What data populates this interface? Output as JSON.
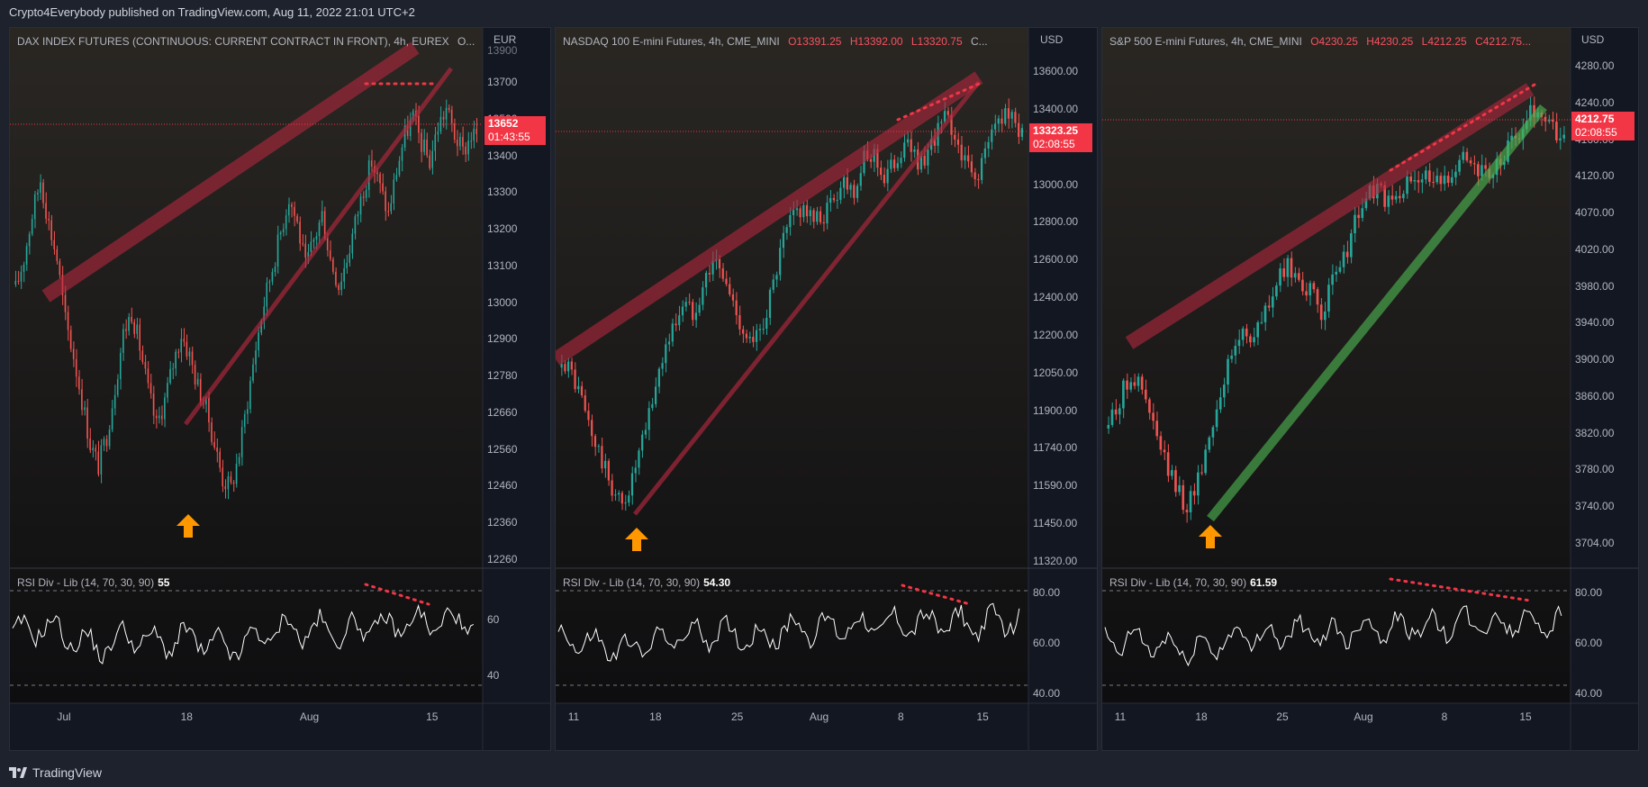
{
  "header": {
    "publisher": "Crypto4Everybody published on TradingView.com, Aug 11, 2022 21:01 UTC+2"
  },
  "footer": {
    "brand": "TradingView"
  },
  "colors": {
    "up": "#26a69a",
    "down": "#ef5350",
    "wedge": "#b2283d",
    "support": "#4caf50",
    "price_tag": "#f23645",
    "arrow": "#ff9800"
  },
  "panels": [
    {
      "id": "dax",
      "legend": {
        "title": "DAX INDEX FUTURES (CONTINUOUS: CURRENT CONTRACT IN FRONT), 4h, EUREX",
        "ohlc": "O..."
      },
      "currency": "EUR",
      "ticks": [
        "13700",
        "13500",
        "13400",
        "13300",
        "13200",
        "13100",
        "13000",
        "12900",
        "12780",
        "12660",
        "12560",
        "12460",
        "12360",
        "12260"
      ],
      "top_tick_cut": "13900",
      "price": {
        "value": "13652",
        "timer": "01:43:55"
      },
      "rsi": {
        "label": "RSI Div - Lib (14, 70, 30, 90)",
        "value": "55",
        "ticks": [
          "60",
          "40"
        ]
      },
      "xticks": [
        "Jul",
        "18",
        "Aug",
        "15"
      ],
      "series_pct": [
        0.55,
        0.62,
        0.72,
        0.8,
        0.7,
        0.62,
        0.48,
        0.4,
        0.3,
        0.2,
        0.15,
        0.22,
        0.33,
        0.45,
        0.5,
        0.42,
        0.32,
        0.24,
        0.3,
        0.38,
        0.45,
        0.4,
        0.33,
        0.28,
        0.2,
        0.12,
        0.1,
        0.18,
        0.3,
        0.42,
        0.52,
        0.6,
        0.68,
        0.76,
        0.7,
        0.6,
        0.66,
        0.72,
        0.62,
        0.56,
        0.62,
        0.7,
        0.78,
        0.84,
        0.78,
        0.72,
        0.82,
        0.9,
        0.94,
        0.88,
        0.84,
        0.92,
        0.96,
        0.9,
        0.86,
        0.9
      ]
    },
    {
      "id": "nasdaq",
      "legend": {
        "title": "NASDAQ 100 E-mini Futures, 4h, CME_MINI",
        "o": "O13391.25",
        "h": "H13392.00",
        "l": "L13320.75",
        "c": "C..."
      },
      "currency": "USD",
      "ticks": [
        "13600.00",
        "13400.00",
        "13200.00",
        "13000.00",
        "12800.00",
        "12600.00",
        "12400.00",
        "12200.00",
        "12050.00",
        "11900.00",
        "11740.00",
        "11590.00",
        "11450.00",
        "11320.00"
      ],
      "price": {
        "value": "13323.25",
        "timer": "02:08:55"
      },
      "rsi": {
        "label": "RSI Div - Lib (14, 70, 30, 90)",
        "value": "54.30",
        "ticks": [
          "80.00",
          "60.00",
          "40.00"
        ]
      },
      "xticks": [
        "11",
        "18",
        "25",
        "Aug",
        "8",
        "15"
      ],
      "series_pct": [
        0.4,
        0.36,
        0.3,
        0.22,
        0.16,
        0.1,
        0.06,
        0.12,
        0.2,
        0.3,
        0.4,
        0.46,
        0.52,
        0.5,
        0.56,
        0.62,
        0.58,
        0.52,
        0.46,
        0.42,
        0.48,
        0.56,
        0.66,
        0.72,
        0.74,
        0.7,
        0.72,
        0.76,
        0.8,
        0.78,
        0.84,
        0.86,
        0.8,
        0.84,
        0.88,
        0.86,
        0.82,
        0.9,
        0.94,
        0.9,
        0.84,
        0.8,
        0.86,
        0.92,
        0.96,
        0.92
      ]
    },
    {
      "id": "spx",
      "legend": {
        "title": "S&P 500 E-mini Futures, 4h, CME_MINI",
        "o": "O4230.25",
        "h": "H4230.25",
        "l": "L4212.25",
        "c": "C4212.75..."
      },
      "currency": "USD",
      "ticks": [
        "4280.00",
        "4240.00",
        "4160.00",
        "4120.00",
        "4070.00",
        "4020.00",
        "3980.00",
        "3940.00",
        "3900.00",
        "3860.00",
        "3820.00",
        "3780.00",
        "3740.00",
        "3704.00"
      ],
      "price": {
        "value": "4212.75",
        "timer": "02:08:55"
      },
      "rsi": {
        "label": "RSI Div - Lib (14, 70, 30, 90)",
        "value": "61.59",
        "ticks": [
          "80.00",
          "60.00",
          "40.00"
        ]
      },
      "xticks": [
        "11",
        "18",
        "25",
        "Aug",
        "8",
        "15"
      ],
      "series_pct": [
        0.25,
        0.3,
        0.36,
        0.32,
        0.24,
        0.16,
        0.1,
        0.06,
        0.12,
        0.22,
        0.32,
        0.4,
        0.46,
        0.44,
        0.5,
        0.56,
        0.6,
        0.58,
        0.54,
        0.5,
        0.56,
        0.62,
        0.7,
        0.76,
        0.78,
        0.74,
        0.76,
        0.8,
        0.82,
        0.78,
        0.8,
        0.84,
        0.86,
        0.82,
        0.8,
        0.84,
        0.88,
        0.92,
        0.96,
        0.94,
        0.9
      ]
    }
  ]
}
